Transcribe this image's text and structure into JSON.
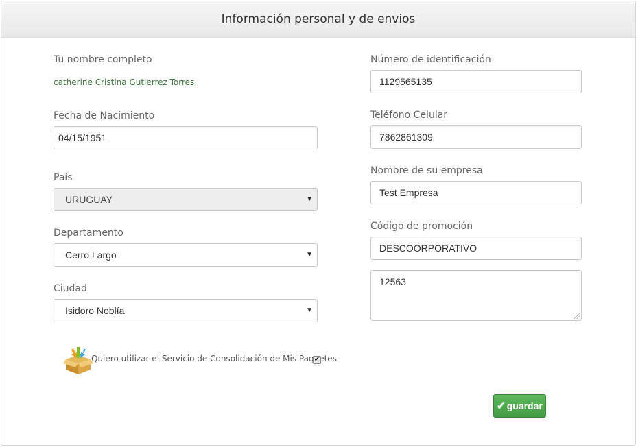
{
  "header": {
    "title": "Información personal y de envios"
  },
  "left": {
    "name_label": "Tu nombre completo",
    "name_value": "catherine Cristina Gutierrez Torres",
    "birth_label": "Fecha de Nacimiento",
    "birth_value": "04/15/1951",
    "country_label": "País",
    "country_value": "URUGUAY",
    "department_label": "Departamento",
    "department_value": "Cerro Largo",
    "city_label": "Ciudad",
    "city_value": "Isidoro Noblía"
  },
  "right": {
    "id_label": "Número de identificación",
    "id_value": "1129565135",
    "phone_label": "Teléfono Celular",
    "phone_value": "7862861309",
    "company_label": "Nombre de su empresa",
    "company_value": "Test Empresa",
    "promo_label": "Código de promoción",
    "promo_value": "DESCOORPORATIVO",
    "notes_value": "12563"
  },
  "consolidation": {
    "label": "Quiero utilizar el Servicio de Consolidación de Mis Paquetes",
    "checked": true,
    "icon": "package-box-icon"
  },
  "actions": {
    "save_label": "guardar",
    "save_color": "#5cb85c"
  }
}
